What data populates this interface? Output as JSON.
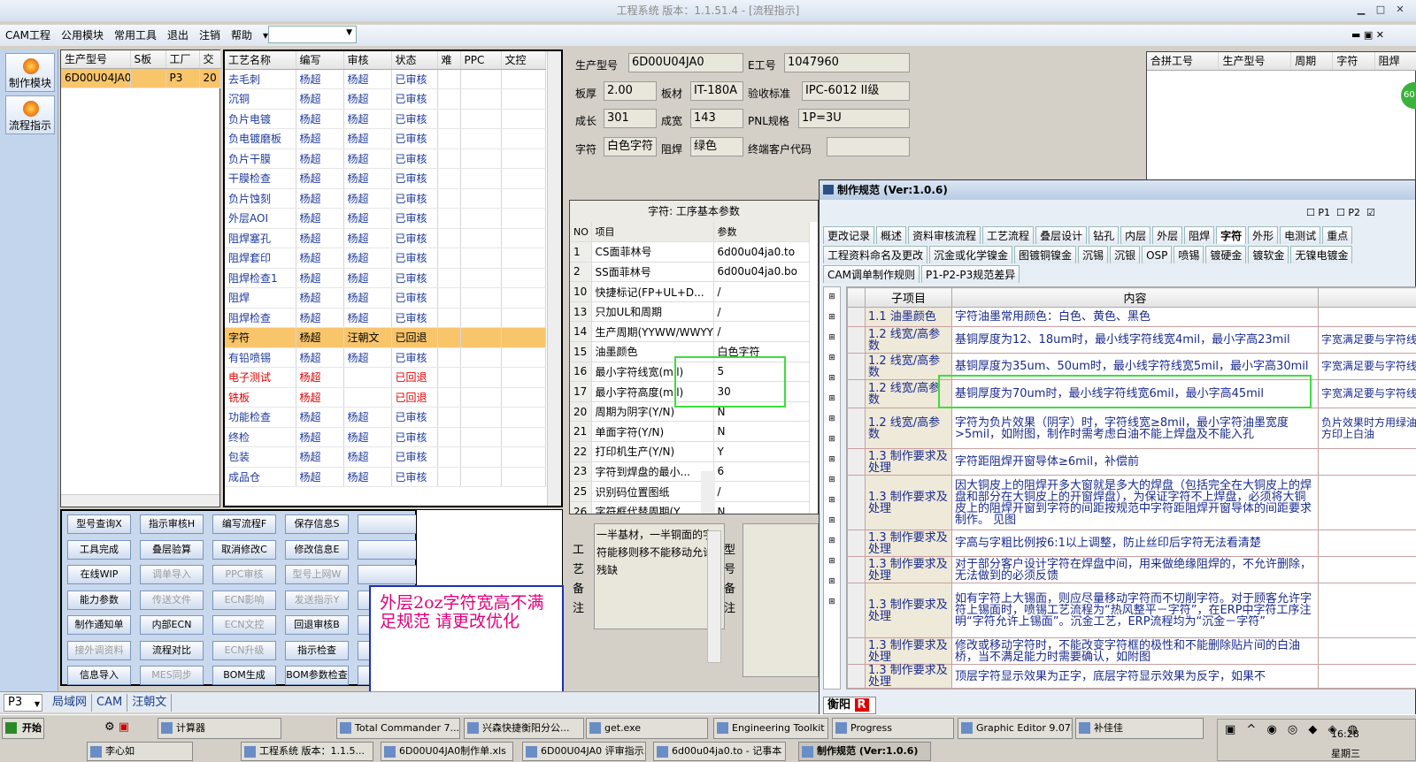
{
  "window_title": "工程系统   版本：1.1.51.4 - [流程指示]",
  "menu": [
    "CAM工程",
    "公用模块",
    "常用工具",
    "退出",
    "注销",
    "帮助"
  ],
  "leftbar": [
    {
      "label": "制作模块"
    },
    {
      "label": "流程指示"
    }
  ],
  "order_table": {
    "headers": [
      "生产型号",
      "S板",
      "工厂",
      "交"
    ],
    "rows": [
      [
        "6D00U04JA0",
        "",
        "P3",
        "20"
      ]
    ]
  },
  "process_table": {
    "headers": [
      "工艺名称",
      "编写",
      "审核",
      "状态",
      "难",
      "PPC",
      "文控"
    ],
    "rows": [
      {
        "c": [
          "去毛刺",
          "杨超",
          "杨超",
          "已审核"
        ],
        "cls": "blue"
      },
      {
        "c": [
          "沉铜",
          "杨超",
          "杨超",
          "已审核"
        ],
        "cls": "blue"
      },
      {
        "c": [
          "负片电镀",
          "杨超",
          "杨超",
          "已审核"
        ],
        "cls": "blue"
      },
      {
        "c": [
          "负电镀磨板",
          "杨超",
          "杨超",
          "已审核"
        ],
        "cls": "blue"
      },
      {
        "c": [
          "负片干膜",
          "杨超",
          "杨超",
          "已审核"
        ],
        "cls": "blue"
      },
      {
        "c": [
          "干膜检查",
          "杨超",
          "杨超",
          "已审核"
        ],
        "cls": "blue"
      },
      {
        "c": [
          "负片蚀刻",
          "杨超",
          "杨超",
          "已审核"
        ],
        "cls": "blue"
      },
      {
        "c": [
          "外层AOI",
          "杨超",
          "杨超",
          "已审核"
        ],
        "cls": "blue"
      },
      {
        "c": [
          "阻焊塞孔",
          "杨超",
          "杨超",
          "已审核"
        ],
        "cls": "blue"
      },
      {
        "c": [
          "阻焊套印",
          "杨超",
          "杨超",
          "已审核"
        ],
        "cls": "blue"
      },
      {
        "c": [
          "阻焊检查1",
          "杨超",
          "杨超",
          "已审核"
        ],
        "cls": "blue"
      },
      {
        "c": [
          "阻焊",
          "杨超",
          "杨超",
          "已审核"
        ],
        "cls": "blue"
      },
      {
        "c": [
          "阻焊检查",
          "杨超",
          "杨超",
          "已审核"
        ],
        "cls": "blue"
      },
      {
        "c": [
          "字符",
          "杨超",
          "汪朝文",
          "已回退"
        ],
        "cls": "sel"
      },
      {
        "c": [
          "有铅喷锡",
          "杨超",
          "杨超",
          "已审核"
        ],
        "cls": "blue"
      },
      {
        "c": [
          "电子测试",
          "杨超",
          "",
          "已回退"
        ],
        "cls": "red"
      },
      {
        "c": [
          "铣板",
          "杨超",
          "",
          "已回退"
        ],
        "cls": "red"
      },
      {
        "c": [
          "功能检查",
          "杨超",
          "杨超",
          "已审核"
        ],
        "cls": "blue"
      },
      {
        "c": [
          "终检",
          "杨超",
          "杨超",
          "已审核"
        ],
        "cls": "blue"
      },
      {
        "c": [
          "包装",
          "杨超",
          "杨超",
          "已审核"
        ],
        "cls": "blue"
      },
      {
        "c": [
          "成品仓",
          "杨超",
          "杨超",
          "已审核"
        ],
        "cls": "blue"
      }
    ]
  },
  "buttons": [
    [
      {
        "t": "型号查询X"
      },
      {
        "t": "指示审核H"
      },
      {
        "t": "编写流程F"
      },
      {
        "t": "保存信息S"
      }
    ],
    [
      {
        "t": "工具完成"
      },
      {
        "t": "叠层验算"
      },
      {
        "t": "取消修改C"
      },
      {
        "t": "修改信息E"
      }
    ],
    [
      {
        "t": "在线WIP"
      },
      {
        "t": "调单导入",
        "d": 1
      },
      {
        "t": "PPC审核",
        "d": 1
      },
      {
        "t": "型号上网W",
        "d": 1
      }
    ],
    [
      {
        "t": "能力参数"
      },
      {
        "t": "传送文件",
        "d": 1
      },
      {
        "t": "ECN影响",
        "d": 1
      },
      {
        "t": "发送指示Y",
        "d": 1
      }
    ],
    [
      {
        "t": "制作通知单"
      },
      {
        "t": "内部ECN"
      },
      {
        "t": "ECN文控",
        "d": 1
      },
      {
        "t": "回退审核B"
      }
    ],
    [
      {
        "t": "接外调资料",
        "d": 1
      },
      {
        "t": "流程对比"
      },
      {
        "t": "ECN升级",
        "d": 1
      },
      {
        "t": "指示检查"
      }
    ],
    [
      {
        "t": "信息导入"
      },
      {
        "t": "MES同步",
        "d": 1
      },
      {
        "t": "BOM生成"
      },
      {
        "t": "BOM参数检查"
      }
    ]
  ],
  "note": "外层2oz字符宽高不满足规范   请更改优化",
  "info": {
    "model_label": "生产型号",
    "model": "6D00U04JA0",
    "e_label": "E工号",
    "e": "1047960",
    "thick_label": "板厚",
    "thick": "2.00",
    "mat_label": "板材",
    "mat": "IT-180A",
    "std_label": "验收标准",
    "std": "IPC-6012 II级",
    "len_label": "成长",
    "len": "301",
    "wid_label": "成宽",
    "wid": "143",
    "pnl_label": "PNL规格",
    "pnl": "1P=3U",
    "char_label": "字符",
    "char": "白色字符",
    "mask_label": "阻焊",
    "mask": "绿色",
    "cust_label": "终端客户代码",
    "cust": ""
  },
  "params": {
    "title": "字符: 工序基本参数",
    "headers": [
      "NO",
      "项目",
      "参数"
    ],
    "rows": [
      [
        "1",
        "CS面菲林号",
        "6d00u04ja0.to"
      ],
      [
        "2",
        "SS面菲林号",
        "6d00u04ja0.bo"
      ],
      [
        "10",
        "快捷标记(FP+UL+D...",
        "/"
      ],
      [
        "13",
        "只加UL和周期",
        "/"
      ],
      [
        "14",
        "生产周期(YYWW/WWYY)",
        "/"
      ],
      [
        "15",
        "油墨颜色",
        "白色字符"
      ],
      [
        "16",
        "最小字符线宽(mil)",
        "5"
      ],
      [
        "17",
        "最小字符高度(mil)",
        "30"
      ],
      [
        "20",
        "周期为阴字(Y/N)",
        "N"
      ],
      [
        "21",
        "单面字符(Y/N)",
        "N"
      ],
      [
        "22",
        "打印机生产(Y/N)",
        "Y"
      ],
      [
        "23",
        "字符到焊盘的最小...",
        "6"
      ],
      [
        "25",
        "识别码位置图纸",
        "/"
      ],
      [
        "26",
        "字符框代替周期(Y...",
        "N"
      ]
    ]
  },
  "memo": {
    "label1": "工艺备注",
    "text": "一半基材，一半铜面的字符能移则移不能移动允许残缺",
    "label2": "型号备注"
  },
  "merge_table": {
    "headers": [
      "合拼工号",
      "生产型号",
      "周期",
      "字符",
      "阻焊"
    ]
  },
  "spec_window": {
    "title": "制作规范 (Ver:1.0.6)",
    "checks": [
      "P1",
      "P2"
    ],
    "tabs1": [
      "更改记录",
      "概述",
      "资料审核流程",
      "工艺流程",
      "叠层设计",
      "钻孔",
      "内层",
      "外层",
      "阻焊",
      "字符",
      "外形",
      "电测试",
      "重点"
    ],
    "tabs2": [
      "工程资料命名及更改",
      "沉金或化学镍金",
      "图镀铜镍金",
      "沉锡",
      "沉银",
      "OSP",
      "喷锡",
      "镀硬金",
      "镀软金",
      "无镍电镀金"
    ],
    "tabs3": [
      "CAM调单制作规则",
      "P1-P2-P3规范差异"
    ],
    "headers": [
      "子项目",
      "内容"
    ],
    "rows": [
      {
        "s": "1.1 油墨颜色",
        "c": "字符油墨常用颜色：白色、黄色、黑色",
        "x": ""
      },
      {
        "s": "1.2 线宽/高参数",
        "c": "基铜厚度为12、18um时，最小线字符线宽4mil，最小字高23mil",
        "x": "字宽满足要与字符线宽"
      },
      {
        "s": "1.2 线宽/高参数",
        "c": "基铜厚度为35um、50um时，最小线字符线宽5mil，最小字高30mil",
        "x": "字宽满足要与字符线宽"
      },
      {
        "s": "1.2 线宽/高参数",
        "c": "基铜厚度为70um时，最小线字符线宽6mil，最小字高45mil",
        "x": "字宽满足要与字符线宽"
      },
      {
        "s": "1.2 线宽/高参数",
        "c": "字符为负片效果（阴字）时，字符线宽≥8mil，最小字符油墨宽度>5mil，如附图，制作时需考虑白油不能上焊盘及不能入孔",
        "x": "负片效果时方用绿油表方印上白油"
      },
      {
        "s": "1.3 制作要求及处理",
        "c": "字符距阻焊开窗导体≥6mil，补偿前",
        "x": ""
      },
      {
        "s": "1.3 制作要求及处理",
        "c": "因大铜皮上的阻焊开多大窗就是多大的焊盘（包括完全在大铜皮上的焊盘和部分在大铜皮上的开窗焊盘），为保证字符不上焊盘，必须将大铜皮上的阻焊开窗到字符的间距按规范中字符距阻焊开窗导体的间距要求制作。 见图",
        "x": ""
      },
      {
        "s": "1.3 制作要求及处理",
        "c": "字高与字粗比例按6:1以上调整，防止丝印后字符无法看清楚",
        "x": ""
      },
      {
        "s": "1.3 制作要求及处理",
        "c": "对于部分客户设计字符在焊盘中间，用来做绝缘阻焊的，不允许删除，无法做到的必须反馈",
        "x": ""
      },
      {
        "s": "1.3 制作要求及处理",
        "c": "如有字符上大锡面，则应尽量移动字符而不切削字符。对于顾客允许字符上锡面时，喷锡工艺流程为“热风整平－字符”，在ERP中字符工序注明“字符允许上锡面”。沉金工艺，ERP流程均为“沉金－字符”",
        "x": ""
      },
      {
        "s": "1.3 制作要求及处理",
        "c": "修改或移动字符时，不能改变字符框的极性和不能删除贴片间的白油桥，当不满足能力时需要确认，如附图",
        "x": ""
      },
      {
        "s": "1.3 制作要求及处理",
        "c": "顶层字符显示效果为正字，底层字符显示效果为反字，如果不",
        "x": ""
      }
    ],
    "bottom": "衡阳"
  },
  "statusbar": {
    "combo": "P3",
    "tabs": [
      "局域网",
      "CAM",
      "汪朝文"
    ]
  },
  "taskbar": {
    "start": "开始",
    "row1": [
      "计算器",
      "Total Commander 7....",
      "兴森快捷衡阳分公...",
      "get.exe",
      "Engineering Toolkit 9...",
      "Progress",
      "Graphic Editor 9.07b...",
      "补佳佳"
    ],
    "row2": [
      "李心如",
      "工程系统   版本：1.1.5...",
      "6D00U04JA0制作单.xls",
      "6D00U04JA0 评审指示...",
      "6d00u04ja0.to - 记事本",
      "制作规范 (Ver:1.0.6)"
    ],
    "time": "16:28",
    "day": "星期三"
  }
}
